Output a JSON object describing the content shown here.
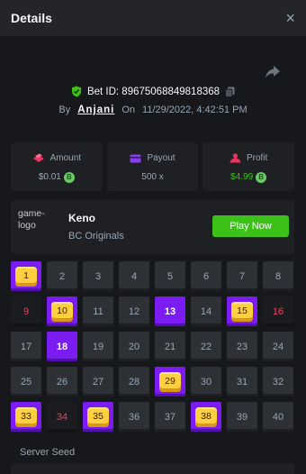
{
  "header": {
    "title": "Details",
    "close_symbol": "×"
  },
  "bet": {
    "id_label": "Bet ID: 89675068849818368",
    "by_label": "By",
    "user": "Anjani",
    "on_label": "On",
    "datetime": "11/29/2022, 4:42:51 PM"
  },
  "stats": {
    "amount": {
      "label": "Amount",
      "value": "$0.01",
      "icon": "coin-stack-icon"
    },
    "payout": {
      "label": "Payout",
      "value": "500 x",
      "icon": "payout-card-icon"
    },
    "profit": {
      "label": "Profit",
      "value": "$4.99",
      "icon": "profit-user-icon"
    },
    "coin_letter": "B"
  },
  "game": {
    "logo_alt": "game-logo",
    "name": "Keno",
    "provider": "BC Originals",
    "play_label": "Play Now"
  },
  "keno_grid": {
    "cells": [
      {
        "n": "1",
        "state": "hit"
      },
      {
        "n": "2",
        "state": "normal"
      },
      {
        "n": "3",
        "state": "normal"
      },
      {
        "n": "4",
        "state": "normal"
      },
      {
        "n": "5",
        "state": "normal"
      },
      {
        "n": "6",
        "state": "normal"
      },
      {
        "n": "7",
        "state": "normal"
      },
      {
        "n": "8",
        "state": "normal"
      },
      {
        "n": "9",
        "state": "miss"
      },
      {
        "n": "10",
        "state": "hit"
      },
      {
        "n": "11",
        "state": "normal"
      },
      {
        "n": "12",
        "state": "normal"
      },
      {
        "n": "13",
        "state": "picked"
      },
      {
        "n": "14",
        "state": "normal"
      },
      {
        "n": "15",
        "state": "hit"
      },
      {
        "n": "16",
        "state": "miss"
      },
      {
        "n": "17",
        "state": "normal"
      },
      {
        "n": "18",
        "state": "picked"
      },
      {
        "n": "19",
        "state": "normal"
      },
      {
        "n": "20",
        "state": "normal"
      },
      {
        "n": "21",
        "state": "normal"
      },
      {
        "n": "22",
        "state": "normal"
      },
      {
        "n": "23",
        "state": "normal"
      },
      {
        "n": "24",
        "state": "normal"
      },
      {
        "n": "25",
        "state": "normal"
      },
      {
        "n": "26",
        "state": "normal"
      },
      {
        "n": "27",
        "state": "normal"
      },
      {
        "n": "28",
        "state": "normal"
      },
      {
        "n": "29",
        "state": "hit"
      },
      {
        "n": "30",
        "state": "normal"
      },
      {
        "n": "31",
        "state": "normal"
      },
      {
        "n": "32",
        "state": "normal"
      },
      {
        "n": "33",
        "state": "hit"
      },
      {
        "n": "34",
        "state": "miss"
      },
      {
        "n": "35",
        "state": "hit"
      },
      {
        "n": "36",
        "state": "normal"
      },
      {
        "n": "37",
        "state": "normal"
      },
      {
        "n": "38",
        "state": "hit"
      },
      {
        "n": "39",
        "state": "normal"
      },
      {
        "n": "40",
        "state": "normal"
      }
    ]
  },
  "seed": {
    "server_label": "Server Seed"
  },
  "colors": {
    "background": "#17181b",
    "panel": "#1e2024",
    "accent_purple": "#7b1df2",
    "accent_green": "#3bc117",
    "miss_red": "#ed4163",
    "gem_yellow": "#ffcf3f"
  },
  "icons": {
    "close": "close-icon",
    "share": "share-icon",
    "verified": "shield-check-icon",
    "copy": "copy-icon"
  }
}
